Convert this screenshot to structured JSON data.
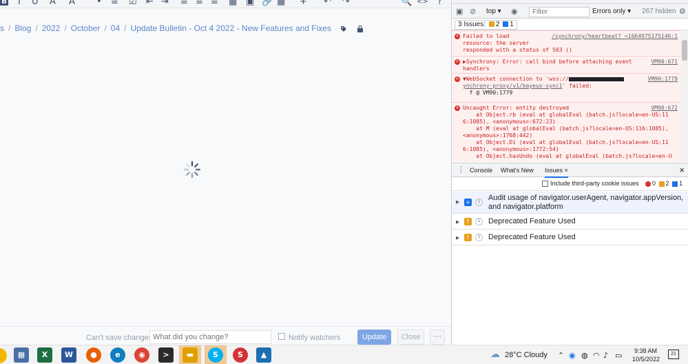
{
  "editor": {
    "breadcrumb": [
      "s",
      "Blog",
      "2022",
      "October",
      "04",
      "Update Bulletin - Oct 4 2022 - New Features and Fixes"
    ],
    "separator": "/",
    "toolbar_glyphs": [
      "B",
      "I",
      "U",
      "A",
      "A",
      "•",
      "≡",
      "☑",
      "⇤",
      "⇥",
      "≡",
      "≡",
      "≡",
      "▦",
      "▣",
      "🔗",
      "▦",
      "+",
      "↶",
      "↷",
      "🔍",
      "<>",
      "?"
    ],
    "bottom": {
      "cant_save": "Can't save changes",
      "change_placeholder": "What did you change?",
      "notify_watchers": "Notify watchers",
      "update": "Update",
      "close": "Close",
      "more": "···"
    }
  },
  "devtools": {
    "context": "top ▾",
    "filter_placeholder": "Filter",
    "levels": "Errors only ▾",
    "hidden": "267 hidden",
    "issues_summary": {
      "label": "3 Issues:",
      "warnings": "2",
      "info": "1"
    },
    "console_messages": [
      {
        "text": "Failed to load\nresource: the server\nresponded with a status of 503 ()",
        "source": "/synchrony/heartbeat?_=1664975175146:1"
      },
      {
        "text": "▶Synchrony: Error: call bind before attaching event\nhandlers",
        "source": "VM90:671"
      },
      {
        "text": "▼WebSocket connection to 'wss://",
        "link": "ynchrony-proxy/v1/bayeux-sync1",
        "tail": "' failed:",
        "frame": "f @ VM90:1779",
        "source": "VM90:1779"
      },
      {
        "text": "Uncaught Error: entity destroyed\n    at Object.rb (eval at globalEval (batch.js?locale=en-US:11\n6:1085), <anonymous>:672:23)\n    at M (eval at globalEval (batch.js?locale=en-US:116:1085),\n<anonymous>:1768:442)\n    at Object.Di (eval at globalEval (batch.js?locale=en-US:11\n6:1085), <anonymous>:1772:54)\n    at Object.hasUndo (eval at globalEval (batch.js?locale=en-U",
        "source": "VM90:672"
      }
    ],
    "drawer": {
      "tabs": [
        "Console",
        "What's New",
        "Issues"
      ],
      "active_tab": "Issues",
      "third_party_label": "Include third-party cookie issues",
      "counts": {
        "errors": "0",
        "warnings": "2",
        "info": "1"
      },
      "issues": [
        {
          "kind": "info",
          "count": "1",
          "text": "Audit usage of navigator.userAgent, navigator.appVersion, and navigator.platform"
        },
        {
          "kind": "warning",
          "count": "1",
          "text": "Deprecated Feature Used"
        },
        {
          "kind": "warning",
          "count": "1",
          "text": "Deprecated Feature Used"
        }
      ]
    }
  },
  "taskbar": {
    "weather": "28°C  Cloudy",
    "time": "9:38 AM",
    "date": "10/5/2022",
    "notifications": "21",
    "apps": [
      {
        "name": "calculator",
        "glyph": "▦",
        "color": "#4a6fa5"
      },
      {
        "name": "excel",
        "glyph": "X",
        "color": "#1d6f42"
      },
      {
        "name": "word",
        "glyph": "W",
        "color": "#2b579a"
      },
      {
        "name": "firefox",
        "glyph": "●",
        "color": "#e66000"
      },
      {
        "name": "edge",
        "glyph": "e",
        "color": "#0f7fc1"
      },
      {
        "name": "chrome",
        "glyph": "◉",
        "color": "#db4437"
      },
      {
        "name": "terminal",
        "glyph": ">",
        "color": "#2b2b2b"
      },
      {
        "name": "sticky-notes",
        "glyph": "▬",
        "color": "#e0a100"
      },
      {
        "name": "skype-badge",
        "glyph": "S",
        "color": "#00aff0"
      },
      {
        "name": "snipping",
        "glyph": "S",
        "color": "#d13438"
      },
      {
        "name": "photos",
        "glyph": "▲",
        "color": "#1e6fb0"
      }
    ]
  }
}
